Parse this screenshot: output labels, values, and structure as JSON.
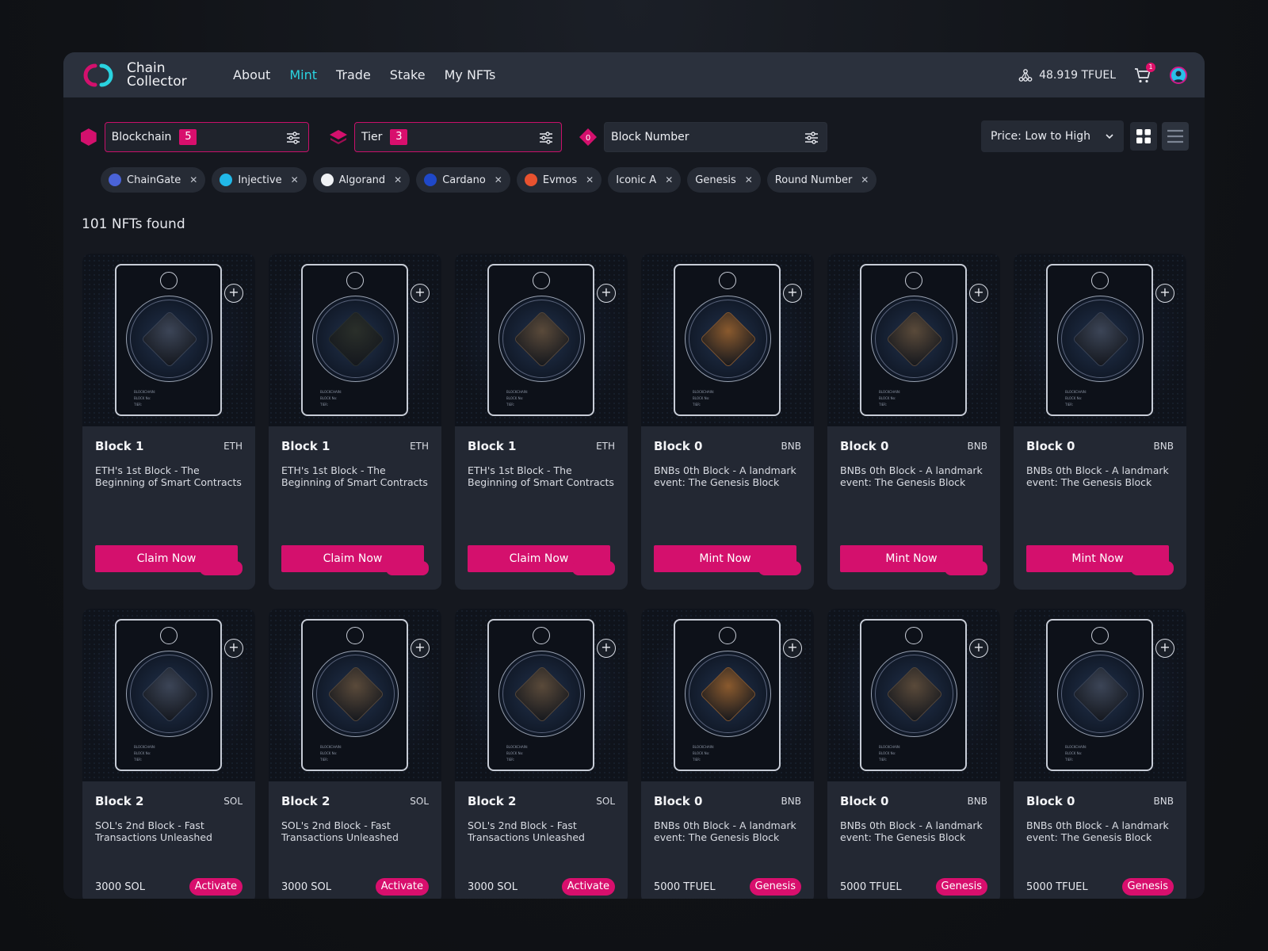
{
  "brand": {
    "line1": "Chain",
    "line2": "Collector"
  },
  "nav": [
    {
      "label": "About",
      "active": false
    },
    {
      "label": "Mint",
      "active": true
    },
    {
      "label": "Trade",
      "active": false
    },
    {
      "label": "Stake",
      "active": false
    },
    {
      "label": "My NFTs",
      "active": false
    }
  ],
  "wallet": {
    "balance": "48.919 TFUEL",
    "cart_count": "1"
  },
  "filters": {
    "blockchain": {
      "label": "Blockchain",
      "count": "5"
    },
    "tier": {
      "label": "Tier",
      "count": "3"
    },
    "block_number": {
      "label": "Block Number",
      "icon_text": "0"
    },
    "sort": "Price: Low to High"
  },
  "chips": [
    {
      "label": "ChainGate",
      "color": "#4a63d8"
    },
    {
      "label": "Injective",
      "color": "#21b8e8"
    },
    {
      "label": "Algorand",
      "color": "#f0f2f5"
    },
    {
      "label": "Cardano",
      "color": "#1f48c8"
    },
    {
      "label": "Evmos",
      "color": "#e8522f"
    },
    {
      "label": "Iconic A",
      "color": ""
    },
    {
      "label": "Genesis",
      "color": ""
    },
    {
      "label": "Round Number",
      "color": ""
    }
  ],
  "results": "101 NFTs found",
  "cards": [
    {
      "title": "Block 1",
      "chain": "ETH",
      "desc": "ETH's 1st Block - The Beginning of Smart Contracts",
      "cta": "Claim Now",
      "cube": "#3c4557"
    },
    {
      "title": "Block 1",
      "chain": "ETH",
      "desc": "ETH's 1st Block - The Beginning of Smart Contracts",
      "cta": "Claim Now",
      "cube": "#2a2f2a"
    },
    {
      "title": "Block 1",
      "chain": "ETH",
      "desc": "ETH's 1st Block - The Beginning of Smart Contracts",
      "cta": "Claim Now",
      "cube": "#5a4a3a"
    },
    {
      "title": "Block 0",
      "chain": "BNB",
      "desc": "BNBs 0th Block - A landmark event: The Genesis Block",
      "cta": "Mint Now",
      "cube": "#8a5a2e"
    },
    {
      "title": "Block 0",
      "chain": "BNB",
      "desc": "BNBs 0th Block - A landmark event: The Genesis Block",
      "cta": "Mint Now",
      "cube": "#5a4a3a"
    },
    {
      "title": "Block 0",
      "chain": "BNB",
      "desc": "BNBs 0th Block - A landmark event: The Genesis Block",
      "cta": "Mint Now",
      "cube": "#3c4557"
    },
    {
      "title": "Block 2",
      "chain": "SOL",
      "desc": "SOL's 2nd Block - Fast Transactions Unleashed",
      "price": "3000 SOL",
      "tag": "Activate",
      "cube": "#3c4557"
    },
    {
      "title": "Block 2",
      "chain": "SOL",
      "desc": "SOL's 2nd Block - Fast Transactions Unleashed",
      "price": "3000 SOL",
      "tag": "Activate",
      "cube": "#5a4a3a"
    },
    {
      "title": "Block 2",
      "chain": "SOL",
      "desc": "SOL's 2nd Block - Fast Transactions Unleashed",
      "price": "3000 SOL",
      "tag": "Activate",
      "cube": "#5a4a3a"
    },
    {
      "title": "Block 0",
      "chain": "BNB",
      "desc": "BNBs 0th Block - A landmark event: The Genesis Block",
      "price": "5000 TFUEL",
      "tag": "Genesis",
      "cube": "#8a5a2e"
    },
    {
      "title": "Block 0",
      "chain": "BNB",
      "desc": "BNBs 0th Block - A landmark event: The Genesis Block",
      "price": "5000 TFUEL",
      "tag": "Genesis",
      "cube": "#5a4a3a"
    },
    {
      "title": "Block 0",
      "chain": "BNB",
      "desc": "BNBs 0th Block - A landmark event: The Genesis Block",
      "price": "5000 TFUEL",
      "tag": "Genesis",
      "cube": "#3c4557"
    }
  ],
  "card_meta": {
    "blockchain": "BLOCKCHAIN:",
    "block_no": "BLOCK No:",
    "tier": "TIER:"
  },
  "colors": {
    "accent": "#d4106d",
    "nav_active": "#2ad3e0"
  }
}
